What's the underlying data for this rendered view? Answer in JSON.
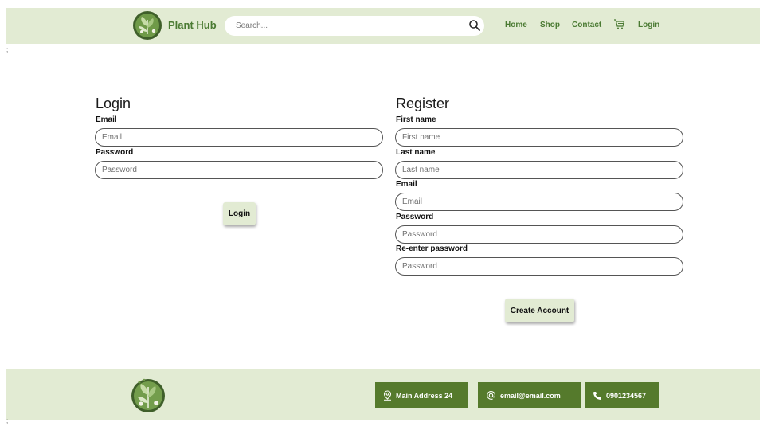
{
  "header": {
    "brand": "Plant Hub",
    "search": {
      "placeholder": "Search...",
      "value": ""
    },
    "nav": {
      "home": "Home",
      "shop": "Shop",
      "contact": "Contact",
      "login": "Login"
    },
    "icons": {
      "search": "search-icon",
      "cart": "cart-icon"
    },
    "colors": {
      "bar": "#e2ebd3",
      "brand_text": "#4a7a32"
    }
  },
  "stray_marks": {
    "top": ";",
    "bottom": ";"
  },
  "login": {
    "title": "Login",
    "email_label": "Email",
    "email_placeholder": "Email",
    "password_label": "Password",
    "password_placeholder": "Password",
    "submit_label": "Login"
  },
  "register": {
    "title": "Register",
    "first_name_label": "First name",
    "first_name_placeholder": "First name",
    "last_name_label": "Last name",
    "last_name_placeholder": "Last name",
    "email_label": "Email",
    "email_placeholder": "Email",
    "password_label": "Password",
    "password_placeholder": "Password",
    "reenter_label": "Re-enter password",
    "reenter_placeholder": "Password",
    "submit_label": "Create Account"
  },
  "footer": {
    "address": "Main Address 24",
    "email": "email@email.com",
    "phone": "0901234567",
    "icons": {
      "address": "location-pin-icon",
      "email": "at-sign-icon",
      "phone": "phone-icon"
    },
    "colors": {
      "bar": "#e2ebd3",
      "button": "#557a2c"
    }
  }
}
